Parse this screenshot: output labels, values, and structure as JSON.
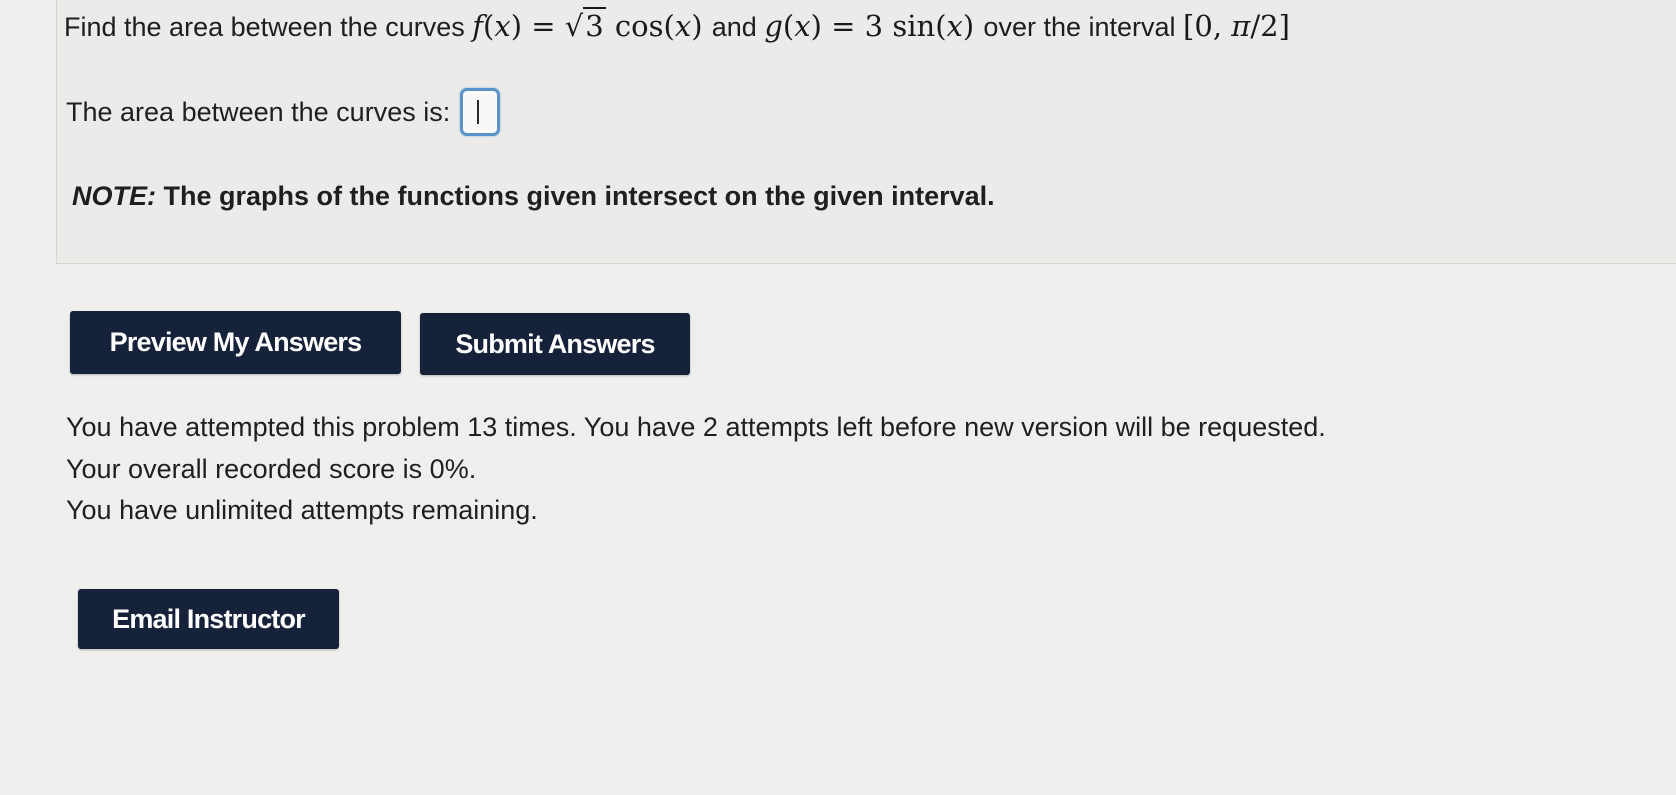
{
  "question": {
    "lead": "Find the area between the curves",
    "f_expr": {
      "fname": "f",
      "var": "x",
      "equals": "=",
      "radicand": "3",
      "func": "cos"
    },
    "and": "and",
    "g_expr": {
      "gname": "g",
      "var": "x",
      "equals": "=",
      "coef": "3",
      "func": "sin"
    },
    "over": "over the interval",
    "interval": {
      "open": "[",
      "start": "0,",
      "pi": "π",
      "slash": "/2",
      "close": "]"
    }
  },
  "answer": {
    "label": "The area between the curves is:",
    "value": ""
  },
  "note": {
    "prefix": "NOTE:",
    "text": "The graphs of the functions given intersect on the given interval."
  },
  "buttons": {
    "preview": "Preview My Answers",
    "submit": "Submit Answers",
    "email": "Email Instructor"
  },
  "status": {
    "line1": "You have attempted this problem 13 times. You have 2 attempts left before new version will be requested.",
    "line2": "Your overall recorded score is 0%.",
    "line3": "You have unlimited attempts remaining."
  },
  "colors": {
    "button_bg": "#16213a",
    "input_border": "#5b93c9",
    "panel_bg": "#ecebea",
    "page_bg": "#efefed"
  }
}
